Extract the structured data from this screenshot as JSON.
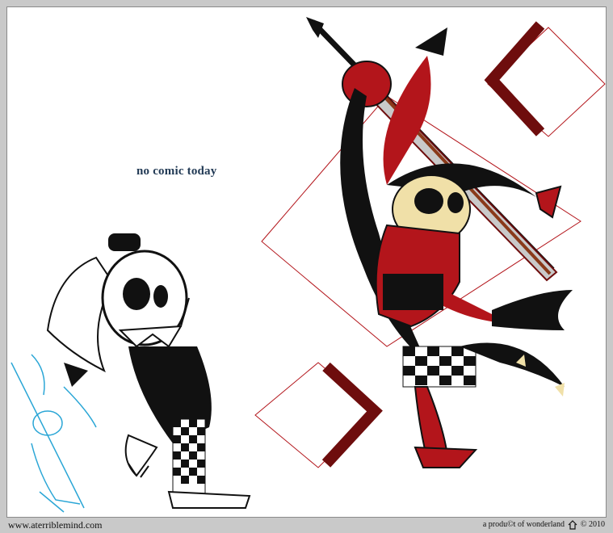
{
  "comic": {
    "message": "no comic today",
    "colors": {
      "red": "#b3151b",
      "darkred": "#6e0d0d",
      "black": "#0a0a0a",
      "bone": "#f0e0a8",
      "cyan": "#2aa6d6"
    }
  },
  "footer": {
    "site": "www.aterriblemind.com",
    "credit": "a produ©t of wonderland",
    "credit_icon": "home-icon",
    "year": "© 2010"
  }
}
